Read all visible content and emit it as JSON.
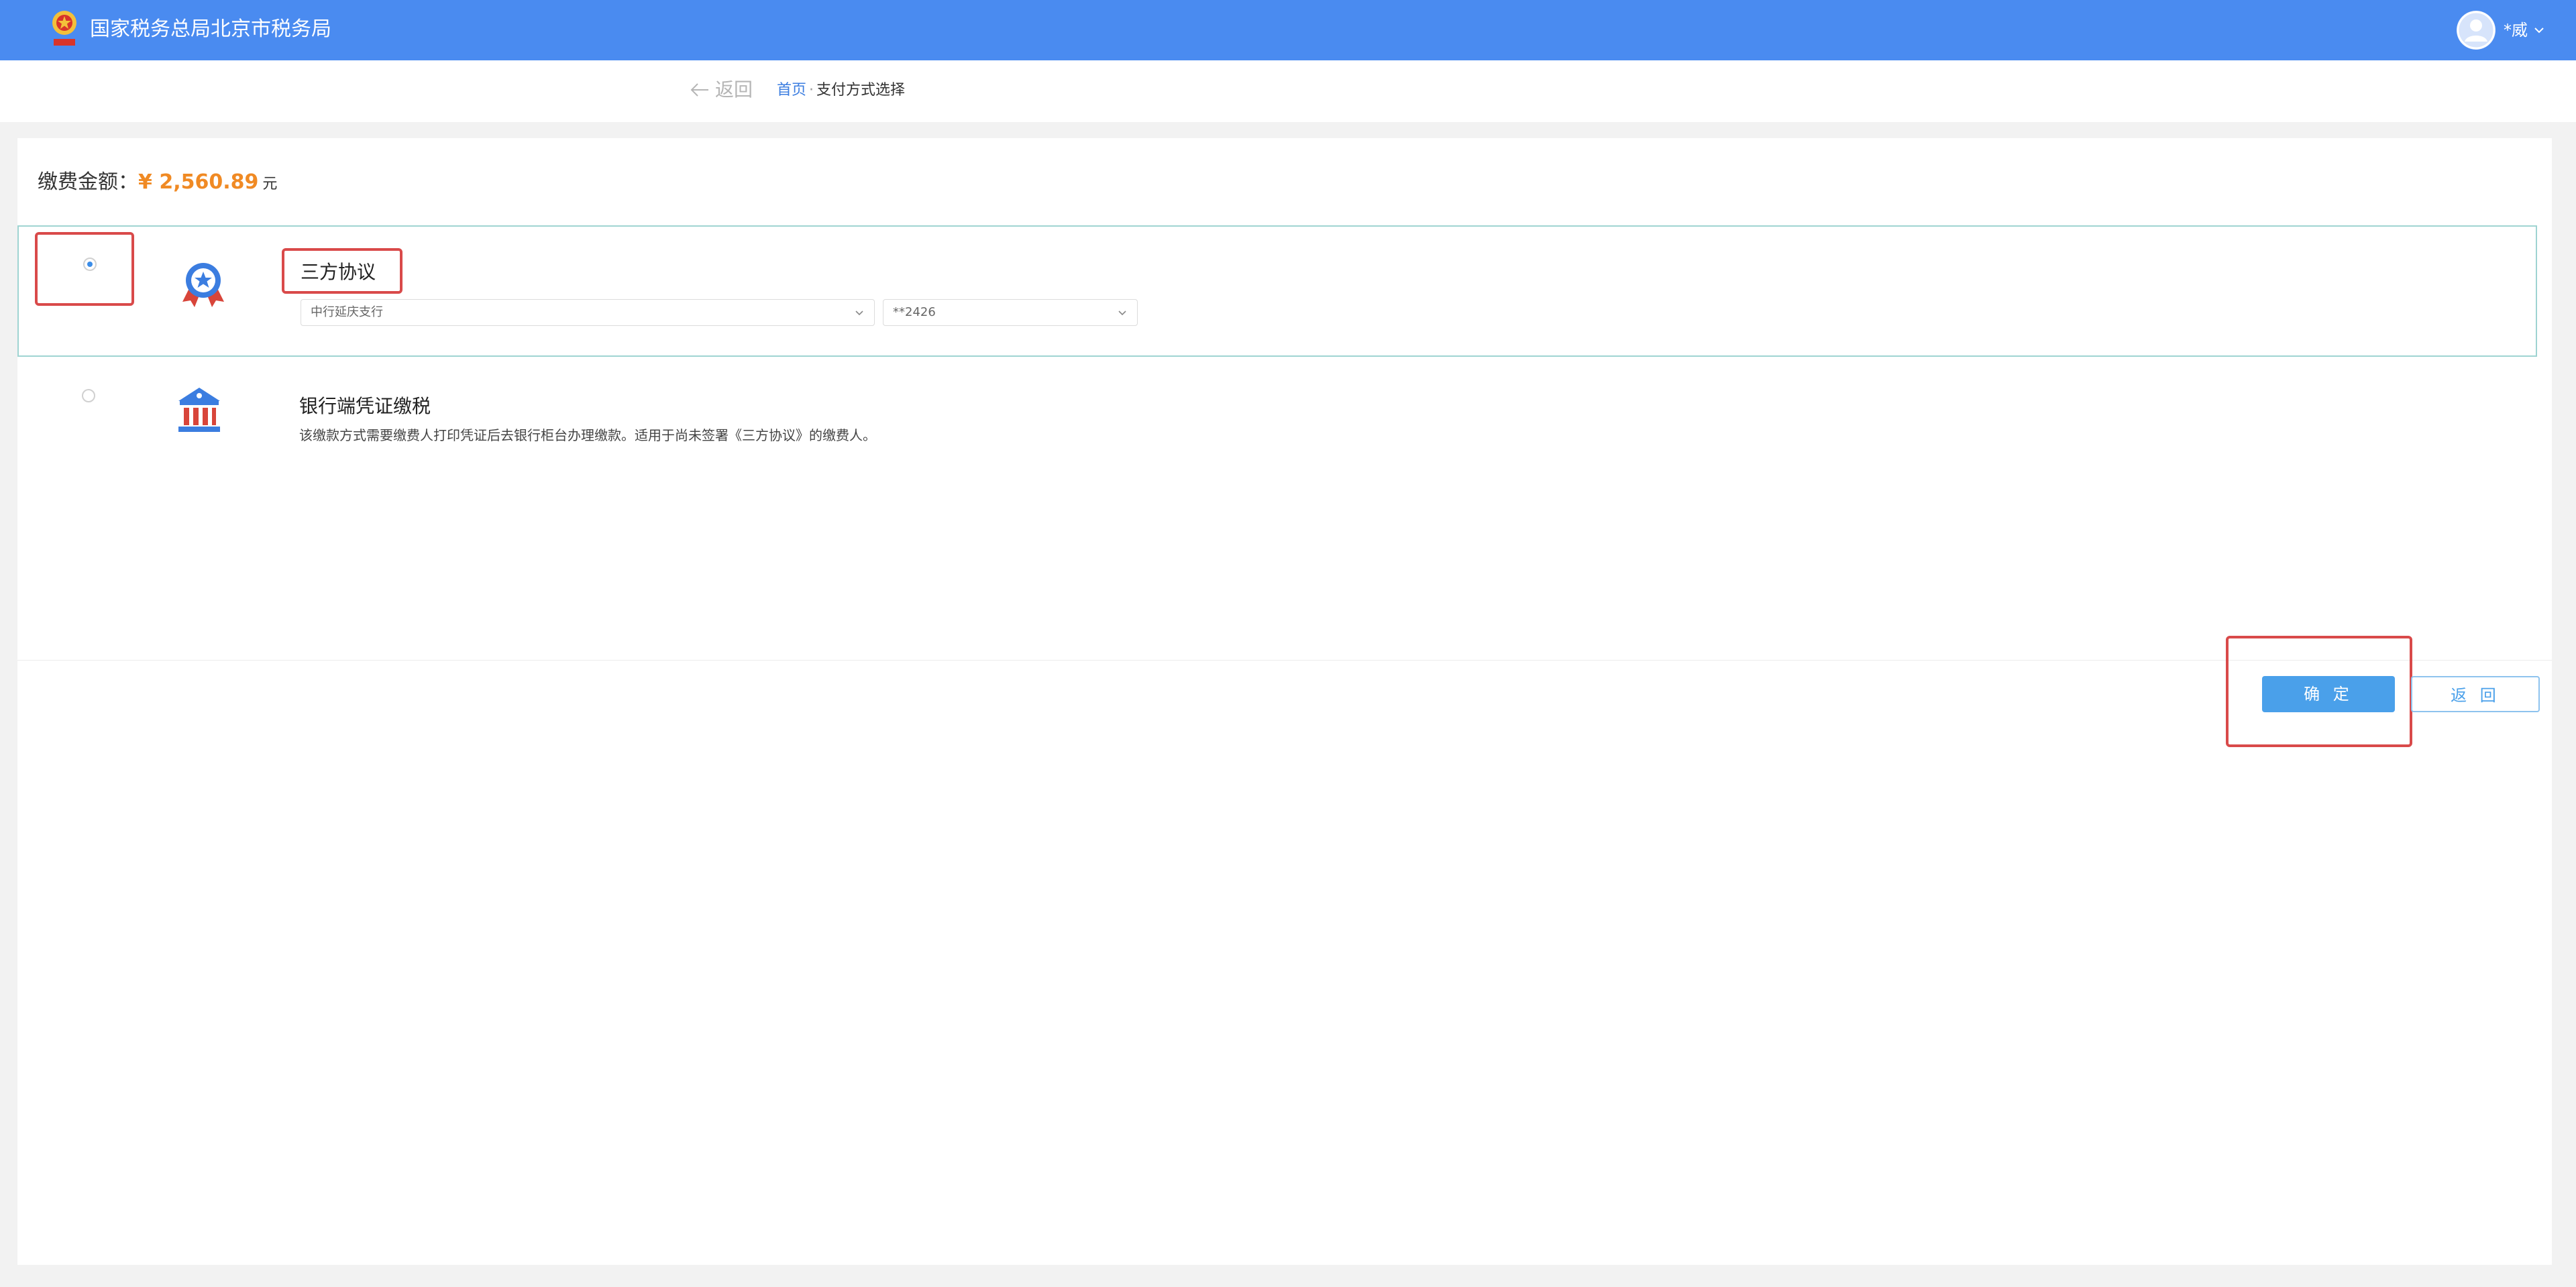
{
  "header": {
    "title": "国家税务总局北京市税务局",
    "user_name": "*威",
    "brand_color": "#4a8bf0"
  },
  "nav": {
    "back_label": "返回",
    "breadcrumb": {
      "home": "首页",
      "separator": "·",
      "current": "支付方式选择"
    }
  },
  "payment": {
    "amount_label": "缴费金额：",
    "amount_value": "¥ 2,560.89",
    "amount_unit": "元",
    "amount_color": "#f08a24"
  },
  "options": [
    {
      "title": "三方协议",
      "selected": true,
      "icon": "badge-star-icon",
      "bank_select": "中行延庆支行",
      "account_select": "**2426"
    },
    {
      "title": "银行端凭证缴税",
      "selected": false,
      "icon": "bank-building-icon",
      "description": "该缴款方式需要缴费人打印凭证后去银行柜台办理缴款。适用于尚未签署《三方协议》的缴费人。"
    }
  ],
  "actions": {
    "confirm_label": "确 定",
    "back_label": "返 回"
  }
}
